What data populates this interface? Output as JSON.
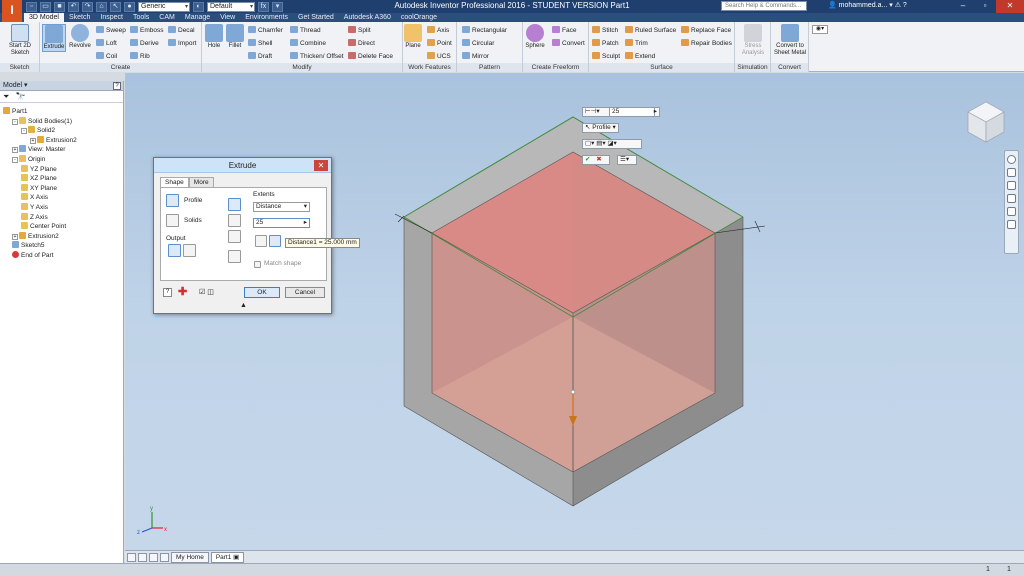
{
  "app": {
    "logo_letter": "I",
    "title": "Autodesk Inventor Professional 2016 - STUDENT VERSION    Part1",
    "search_placeholder": "Search Help & Commands...",
    "user_name": "mohammed.a..."
  },
  "quick_access": {
    "material_value": "Generic",
    "appearance_value": "Default"
  },
  "ribbon_tabs": [
    "3D Model",
    "Sketch",
    "Inspect",
    "Tools",
    "CAM",
    "Manage",
    "View",
    "Environments",
    "Get Started",
    "Autodesk A360",
    "coolOrange"
  ],
  "active_tab": "3D Model",
  "ribbon": {
    "sketch": {
      "label": "Sketch",
      "start_sketch": "Start 2D Sketch"
    },
    "create": {
      "label": "Create",
      "extrude": "Extrude",
      "revolve": "Revolve",
      "small": [
        "Sweep",
        "Loft",
        "Coil",
        "Emboss",
        "Derive",
        "Rib",
        "Decal",
        "Import"
      ]
    },
    "modify": {
      "label": "Modify",
      "hole": "Hole",
      "fillet": "Fillet",
      "small": [
        "Chamfer",
        "Shell",
        "Draft",
        "Thread",
        "Combine",
        "Thicken/ Offset",
        "Split",
        "Direct",
        "Delete Face"
      ]
    },
    "work_features": {
      "label": "Work Features",
      "plane": "Plane",
      "small": [
        "Axis",
        "Point",
        "UCS"
      ]
    },
    "pattern": {
      "label": "Pattern",
      "small": [
        "Rectangular",
        "Circular",
        "Mirror"
      ]
    },
    "create_freeform": {
      "label": "Create Freeform",
      "sphere": "Sphere",
      "small": [
        "Face",
        "Convert"
      ]
    },
    "surface": {
      "label": "Surface",
      "small": [
        "Stitch",
        "Patch",
        "Sculpt",
        "Ruled Surface",
        "Trim",
        "Extend",
        "Replace Face",
        "Repair Bodies"
      ]
    },
    "simulation": {
      "label": "Simulation",
      "stress": "Stress Analysis"
    },
    "convert": {
      "label": "Convert",
      "sheet_metal": "Convert to Sheet Metal"
    }
  },
  "browser": {
    "title": "Model",
    "items": [
      {
        "label": "Part1",
        "level": 0,
        "icon": "part",
        "exp": ""
      },
      {
        "label": "Solid Bodies(1)",
        "level": 1,
        "icon": "folder",
        "exp": "-"
      },
      {
        "label": "Solid2",
        "level": 2,
        "icon": "solid",
        "exp": "-"
      },
      {
        "label": "Extrusion2",
        "level": 3,
        "icon": "extrusion",
        "exp": "+"
      },
      {
        "label": "View: Master",
        "level": 1,
        "icon": "view",
        "exp": "+"
      },
      {
        "label": "Origin",
        "level": 1,
        "icon": "folder",
        "exp": "-"
      },
      {
        "label": "YZ Plane",
        "level": 2,
        "icon": "plane",
        "exp": ""
      },
      {
        "label": "XZ Plane",
        "level": 2,
        "icon": "plane",
        "exp": ""
      },
      {
        "label": "XY Plane",
        "level": 2,
        "icon": "plane",
        "exp": ""
      },
      {
        "label": "X Axis",
        "level": 2,
        "icon": "axis",
        "exp": ""
      },
      {
        "label": "Y Axis",
        "level": 2,
        "icon": "axis",
        "exp": ""
      },
      {
        "label": "Z Axis",
        "level": 2,
        "icon": "axis",
        "exp": ""
      },
      {
        "label": "Center Point",
        "level": 2,
        "icon": "point",
        "exp": ""
      },
      {
        "label": "Extrusion2",
        "level": 1,
        "icon": "extrusion",
        "exp": "+"
      },
      {
        "label": "Sketch5",
        "level": 1,
        "icon": "sketch",
        "exp": ""
      },
      {
        "label": "End of Part",
        "level": 1,
        "icon": "end",
        "exp": ""
      }
    ]
  },
  "dialog": {
    "title": "Extrude",
    "tabs": [
      "Shape",
      "More"
    ],
    "active_tab": "Shape",
    "profile_label": "Profile",
    "solids_label": "Solids",
    "output_label": "Output",
    "extents_label": "Extents",
    "extents_value": "Distance",
    "distance_value": "25",
    "match_shape_label": "Match shape",
    "ok_label": "OK",
    "cancel_label": "Cancel",
    "tooltip": "Distance1 = 25.000 mm"
  },
  "viewport_toolbar": {
    "distance_value": "25",
    "profile_label": "Profile"
  },
  "doc_tabs": [
    "My Home",
    "Part1"
  ],
  "active_doc_tab": "Part1",
  "status": {
    "left": "",
    "count1": "1",
    "count2": "1"
  },
  "colors": {
    "title_bar": "#1f3f6e",
    "accent": "#3a7fc5",
    "extrude_preview": "#e58a85",
    "model_gray": "#9e9e9e"
  }
}
